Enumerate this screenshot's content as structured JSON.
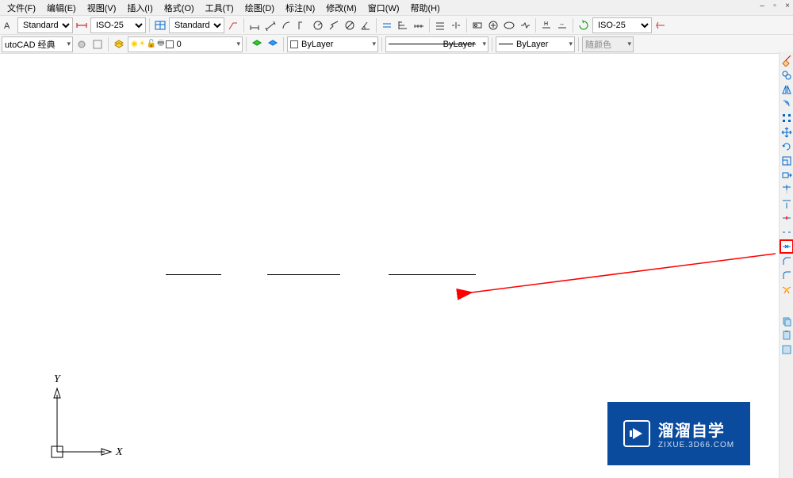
{
  "menus": {
    "file": "文件(F)",
    "edit": "编辑(E)",
    "view": "视图(V)",
    "insert": "插入(I)",
    "format": "格式(O)",
    "tools": "工具(T)",
    "draw": "绘图(D)",
    "dimension": "标注(N)",
    "modify": "修改(M)",
    "window": "窗口(W)",
    "help": "帮助(H)"
  },
  "toolbar1": {
    "text_style": "Standard",
    "dim_style": "ISO-25",
    "table_style": "Standard",
    "dim_style2": "ISO-25"
  },
  "toolbar2": {
    "workspace": "utoCAD 经典",
    "layer_name": "0",
    "color_name": "ByLayer",
    "linetype_name": "ByLayer",
    "lineweight_name": "ByLayer",
    "plot_style": "随颜色"
  },
  "ucs": {
    "x_label": "X",
    "y_label": "Y"
  },
  "watermark": {
    "title": "溜溜自学",
    "url": "ZIXUE.3D66.COM"
  },
  "right_tools": [
    "erase",
    "copy",
    "mirror",
    "offset",
    "array",
    "move",
    "rotate",
    "scale",
    "stretch",
    "trim",
    "extend",
    "break-at",
    "break",
    "join",
    "chamfer",
    "fillet",
    "explode",
    "lengthen",
    "copy2",
    "paste"
  ]
}
